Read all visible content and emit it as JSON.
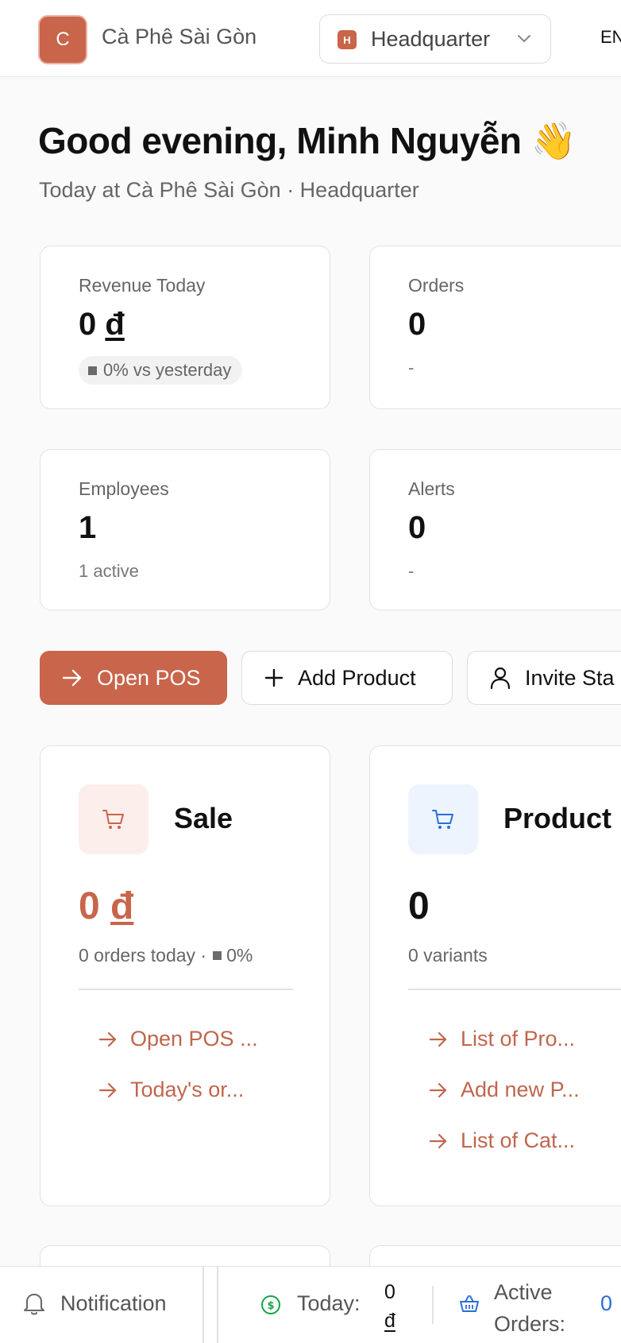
{
  "header": {
    "logo_letter": "C",
    "shop_name": "Cà Phê Sài Gòn",
    "branch_badge": "H",
    "branch_name": "Headquarter",
    "language": "EN"
  },
  "greeting": {
    "title": "Good evening, Minh Nguyễn 👋",
    "subtitle": "Today at Cà Phê Sài Gòn · Headquarter"
  },
  "stats": {
    "revenue": {
      "label": "Revenue Today",
      "value": "0",
      "currency": "đ",
      "change": "0% vs yesterday"
    },
    "orders": {
      "label": "Orders",
      "value": "0",
      "sub": "-"
    },
    "employees": {
      "label": "Employees",
      "value": "1",
      "sub": "1 active"
    },
    "alerts": {
      "label": "Alerts",
      "value": "0",
      "sub": "-"
    }
  },
  "actions": {
    "open_pos": "Open POS",
    "add_product": "Add Product",
    "invite_staff": "Invite Sta"
  },
  "modules": {
    "sale": {
      "title": "Sale",
      "value": "0",
      "currency": "đ",
      "sub": "0 orders today ·",
      "sub_change": "0%",
      "links": [
        "Open POS ...",
        "Today's or..."
      ],
      "accent": "#c8654a"
    },
    "product": {
      "title": "Product",
      "value": "0",
      "sub": "0 variants",
      "links": [
        "List of Pro...",
        "Add new P...",
        "List of Cat..."
      ],
      "accent": "#2a6fd6"
    }
  },
  "bottom_bar": {
    "notification": "Notification",
    "today_label": "Today:",
    "today_value": "0",
    "today_currency": "đ",
    "active_orders_label_1": "Active",
    "active_orders_label_2": "Orders:",
    "active_orders_value": "0"
  },
  "colors": {
    "brand": "#c8654a",
    "link": "#c0664d",
    "blue": "#2a6fd6",
    "green": "#16a34a"
  }
}
